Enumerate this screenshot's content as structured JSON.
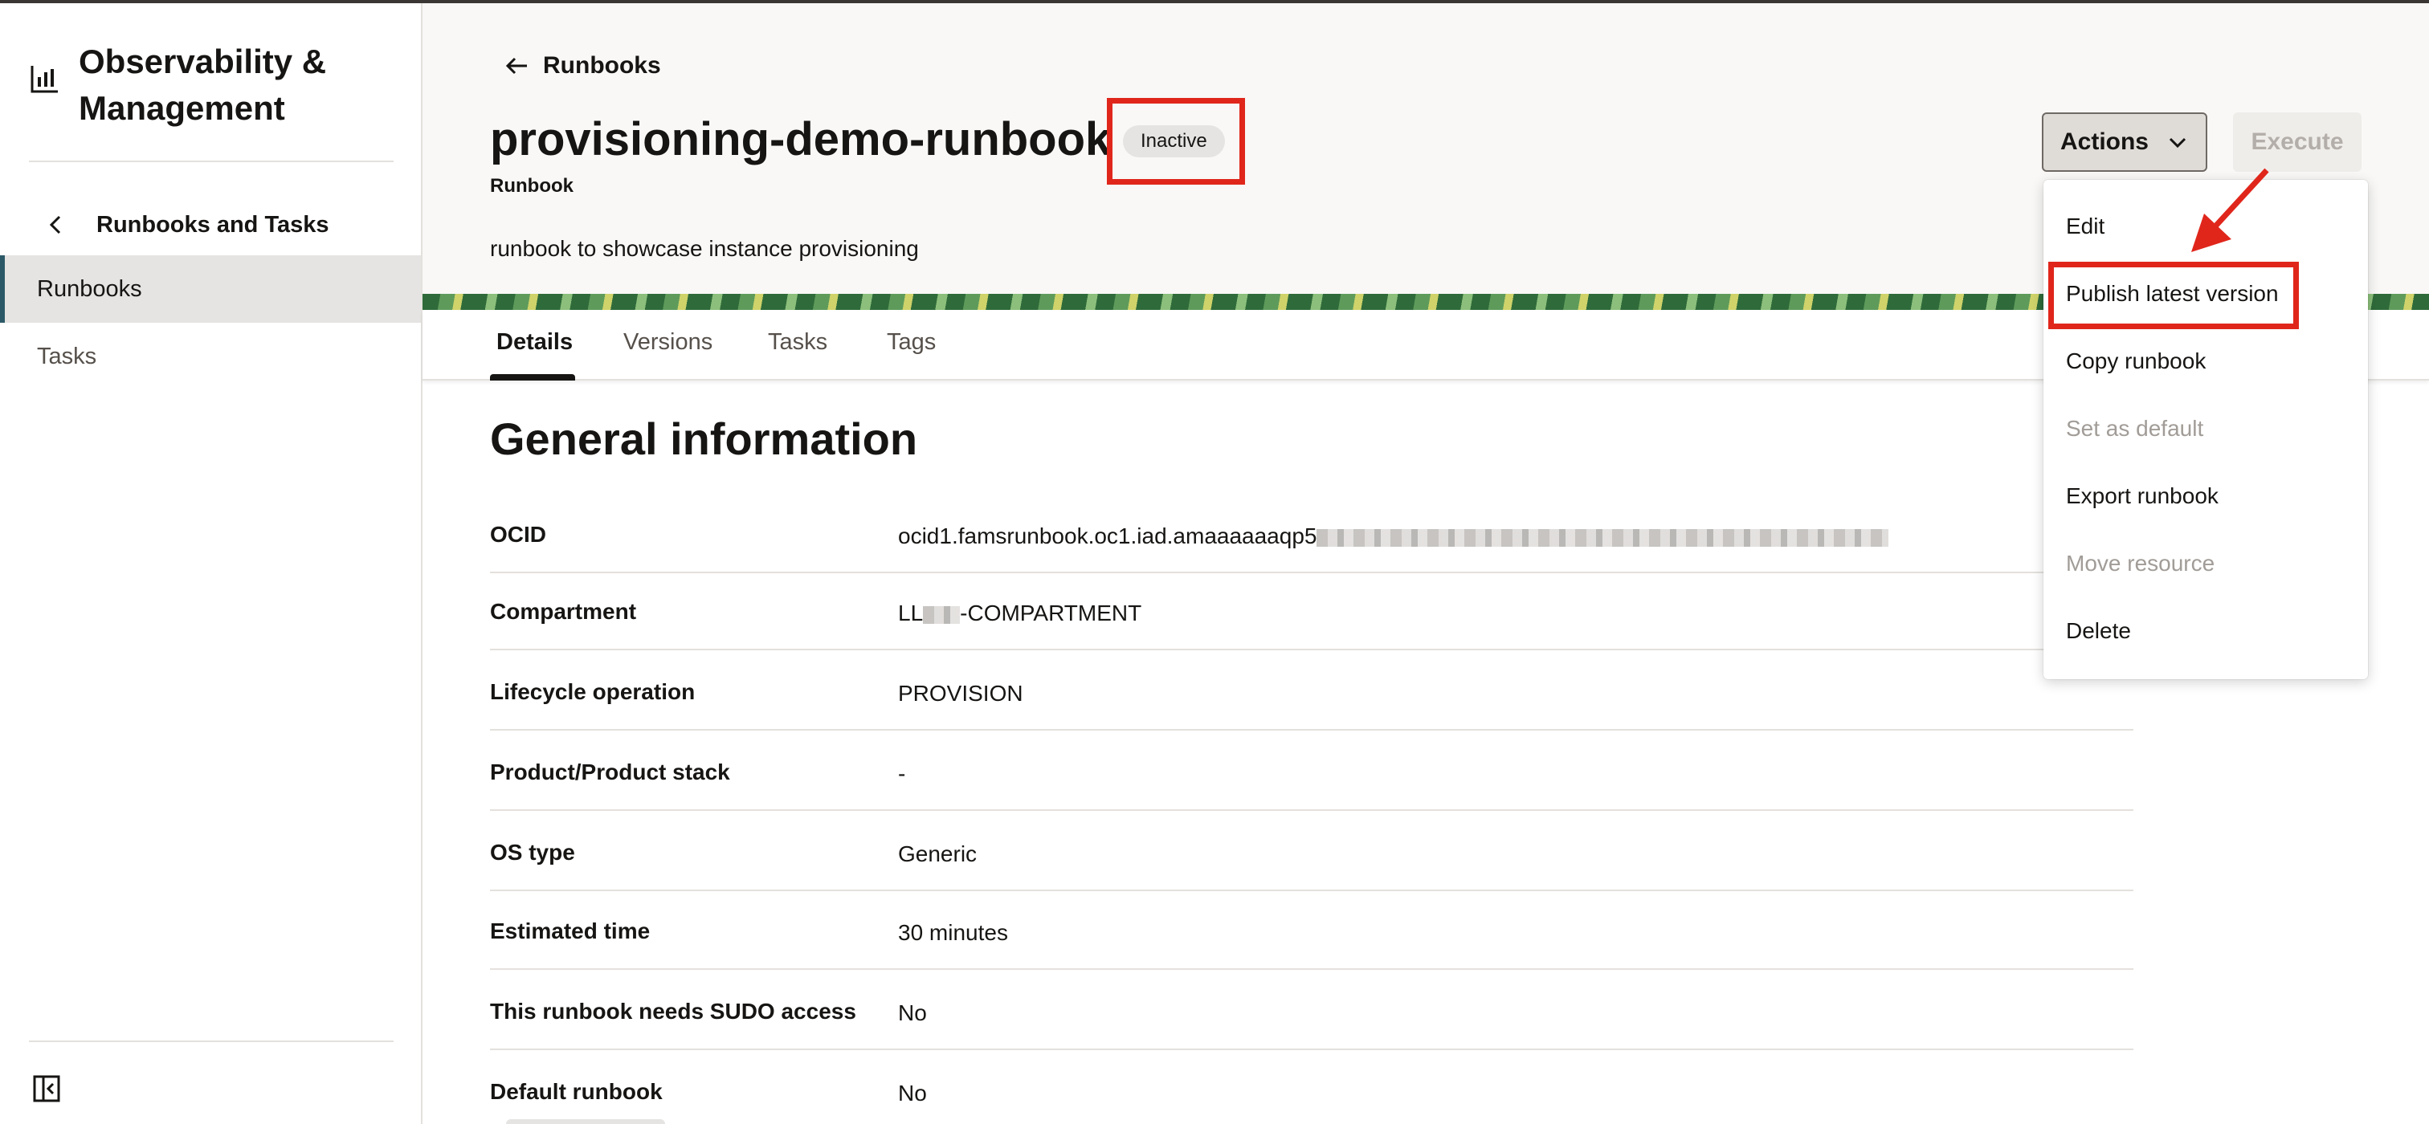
{
  "sidebar": {
    "title": "Observability & Management",
    "back_label": "Runbooks and Tasks",
    "items": [
      {
        "label": "Runbooks"
      },
      {
        "label": "Tasks"
      }
    ]
  },
  "header": {
    "back_label": "Runbooks",
    "title": "provisioning-demo-runbook",
    "status": "Inactive",
    "subtitle": "Runbook",
    "description": "runbook to showcase instance provisioning",
    "actions_label": "Actions",
    "execute_label": "Execute"
  },
  "tabs": [
    {
      "label": "Details"
    },
    {
      "label": "Versions"
    },
    {
      "label": "Tasks"
    },
    {
      "label": "Tags"
    }
  ],
  "general_info": {
    "title": "General information",
    "rows": [
      {
        "label": "OCID",
        "value_prefix": "ocid1.famsrunbook.oc1.iad.amaaaaaaqp5",
        "value_suffix": ""
      },
      {
        "label": "Compartment",
        "value_prefix": "LL",
        "value_suffix": "-COMPARTMENT"
      },
      {
        "label": "Lifecycle operation",
        "value_prefix": "PROVISION",
        "value_suffix": ""
      },
      {
        "label": "Product/Product stack",
        "value_prefix": "-",
        "value_suffix": ""
      },
      {
        "label": "OS type",
        "value_prefix": "Generic",
        "value_suffix": ""
      },
      {
        "label": "Estimated time",
        "value_prefix": "30 minutes",
        "value_suffix": ""
      },
      {
        "label": "This runbook needs SUDO access",
        "value_prefix": "No",
        "value_suffix": ""
      },
      {
        "label": "Default runbook",
        "value_prefix": "No",
        "value_suffix": ""
      }
    ]
  },
  "actions_menu": {
    "items": [
      {
        "label": "Edit",
        "enabled": true
      },
      {
        "label": "Publish latest version",
        "enabled": true
      },
      {
        "label": "Copy runbook",
        "enabled": true
      },
      {
        "label": "Set as default",
        "enabled": false
      },
      {
        "label": "Export runbook",
        "enabled": true
      },
      {
        "label": "Move resource",
        "enabled": false
      },
      {
        "label": "Delete",
        "enabled": true
      }
    ]
  },
  "colors": {
    "highlight": "#e0261b",
    "active_nav_accent": "#2c5967",
    "text": "#161513",
    "disabled_text": "#a19c97"
  }
}
